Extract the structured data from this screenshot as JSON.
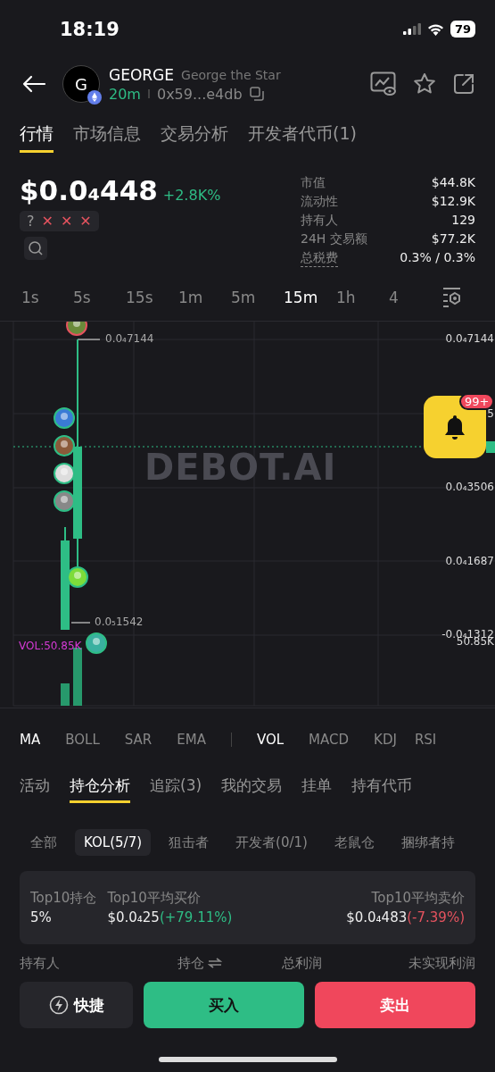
{
  "status_bar": {
    "time": "18:19",
    "battery": "79"
  },
  "token": {
    "symbol": "GEORGE",
    "name": "George the Star",
    "avatar_letter": "G",
    "age": "20m",
    "address": "0x59...e4db"
  },
  "tabs": [
    {
      "label": "行情",
      "selected": true
    },
    {
      "label": "市场信息",
      "selected": false
    },
    {
      "label": "交易分析",
      "selected": false
    },
    {
      "label": "开发者代币(1)",
      "selected": false
    }
  ],
  "price": {
    "value": "$0.0₄448",
    "change": "+2.8K%"
  },
  "risk_flags": [
    {
      "symbol": "?",
      "kind": "unknown"
    },
    {
      "symbol": "✕",
      "kind": "fail"
    },
    {
      "symbol": "✕",
      "kind": "fail"
    },
    {
      "symbol": "✕",
      "kind": "fail"
    }
  ],
  "stats": [
    {
      "label": "市值",
      "value": "$44.8K"
    },
    {
      "label": "流动性",
      "value": "$12.9K"
    },
    {
      "label": "持有人",
      "value": "129"
    },
    {
      "label": "24H 交易额",
      "value": "$77.2K"
    },
    {
      "label": "总税费",
      "value": "0.3% / 0.3%"
    }
  ],
  "timeframes": [
    {
      "label": "1s",
      "selected": false
    },
    {
      "label": "5s",
      "selected": false
    },
    {
      "label": "15s",
      "selected": false
    },
    {
      "label": "1m",
      "selected": false
    },
    {
      "label": "5m",
      "selected": false
    },
    {
      "label": "15m",
      "selected": true
    },
    {
      "label": "1h",
      "selected": false
    },
    {
      "label": "4",
      "selected": false
    }
  ],
  "chart": {
    "high_label": "0.0₄7144",
    "low_label": "0.0₅1542",
    "volume_label": "VOL:50.85K",
    "watermark": "DEBOT.AI",
    "axis_labels": [
      "0.0₄7144",
      "5",
      "0.0₄3506",
      "0.0₄1687",
      "-0.0₄1312"
    ],
    "volume_axis_label": "50.85K",
    "alert_badge": "99+"
  },
  "indicators": {
    "main": [
      {
        "label": "MA",
        "selected": true
      },
      {
        "label": "BOLL",
        "selected": false
      },
      {
        "label": "SAR",
        "selected": false
      },
      {
        "label": "EMA",
        "selected": false
      }
    ],
    "sub": [
      {
        "label": "VOL",
        "selected": true
      },
      {
        "label": "MACD",
        "selected": false
      },
      {
        "label": "KDJ",
        "selected": false
      },
      {
        "label": "RSI",
        "selected": false
      }
    ]
  },
  "section_tabs": [
    {
      "label": "活动",
      "selected": false
    },
    {
      "label": "持仓分析",
      "selected": true
    },
    {
      "label": "追踪(3)",
      "selected": false
    },
    {
      "label": "我的交易",
      "selected": false
    },
    {
      "label": "挂单",
      "selected": false
    },
    {
      "label": "持有代币",
      "selected": false
    }
  ],
  "filters": [
    {
      "label": "全部",
      "selected": false
    },
    {
      "label": "KOL(5/7)",
      "selected": true
    },
    {
      "label": "狙击者",
      "selected": false
    },
    {
      "label": "开发者(0/1)",
      "selected": false
    },
    {
      "label": "老鼠仓",
      "selected": false
    },
    {
      "label": "捆绑者持",
      "selected": false
    }
  ],
  "summary": [
    {
      "label": "Top10持仓",
      "value": "5%"
    },
    {
      "label": "Top10平均买价",
      "value": "$0.0₄25",
      "change": "(+79.11%)",
      "color": "#2ebd85"
    },
    {
      "label": "Top10平均卖价",
      "value": "$0.0₄483",
      "change": "(-7.39%)",
      "color": "#e5535f"
    }
  ],
  "columns": [
    "持有人",
    "持仓",
    "总利润",
    "未实现利润"
  ],
  "actions": [
    {
      "label": "快捷",
      "kind": "quick"
    },
    {
      "label": "买入",
      "kind": "buy"
    },
    {
      "label": "卖出",
      "kind": "sell"
    }
  ]
}
